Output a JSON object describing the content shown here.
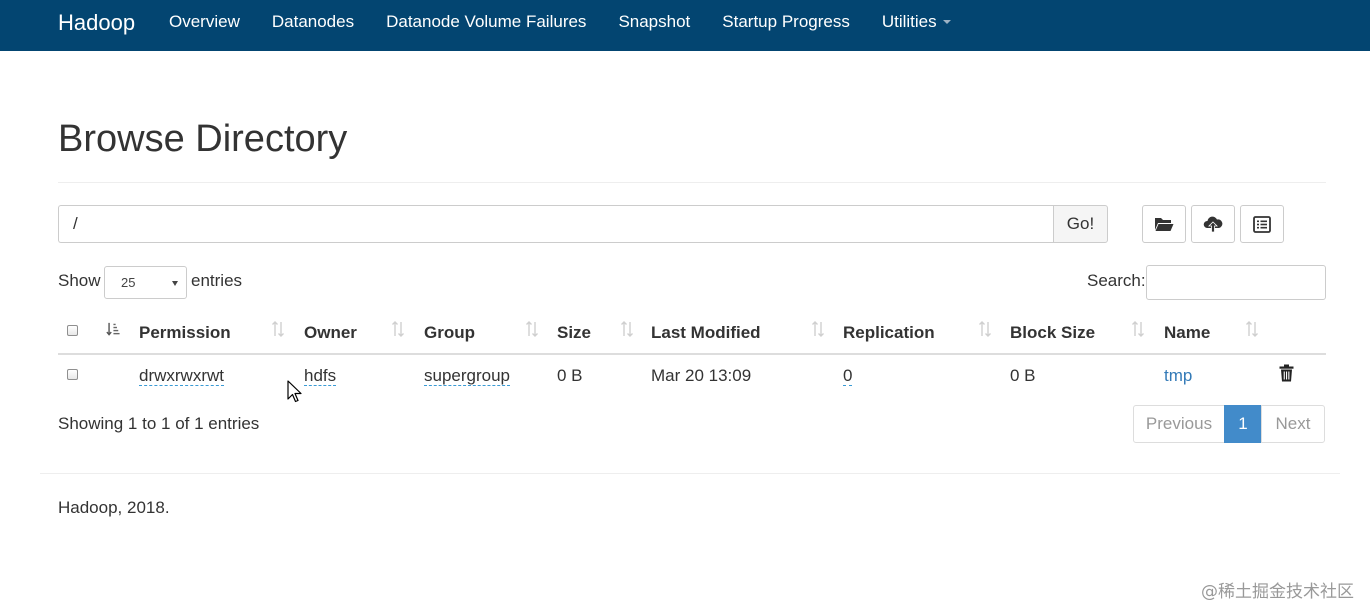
{
  "navbar": {
    "brand": "Hadoop",
    "links": [
      "Overview",
      "Datanodes",
      "Datanode Volume Failures",
      "Snapshot",
      "Startup Progress",
      "Utilities"
    ],
    "background": "#034571"
  },
  "page": {
    "title": "Browse Directory"
  },
  "path_bar": {
    "value": "/",
    "go_label": "Go!"
  },
  "toolbar": {
    "icons": [
      "folder-open-icon",
      "cloud-upload-icon",
      "list-alt-icon"
    ]
  },
  "entries": {
    "show_label": "Show",
    "page_size": "25",
    "suffix_label": "entries"
  },
  "search": {
    "label": "Search:",
    "value": ""
  },
  "table": {
    "columns": [
      "Permission",
      "Owner",
      "Group",
      "Size",
      "Last Modified",
      "Replication",
      "Block Size",
      "Name"
    ],
    "rows": [
      {
        "permission": "drwxrwxrwt",
        "owner": "hdfs",
        "group": "supergroup",
        "size": "0 B",
        "last_modified": "Mar 20 13:09",
        "replication": "0",
        "block_size": "0 B",
        "name": "tmp"
      }
    ]
  },
  "info": "Showing 1 to 1 of 1 entries",
  "pagination": {
    "previous": "Previous",
    "current": "1",
    "next": "Next"
  },
  "footer": {
    "copyright": "Hadoop, 2018."
  },
  "watermark": "@稀土掘金技术社区",
  "colors": {
    "accent": "#428bca",
    "link": "#337ab7"
  }
}
